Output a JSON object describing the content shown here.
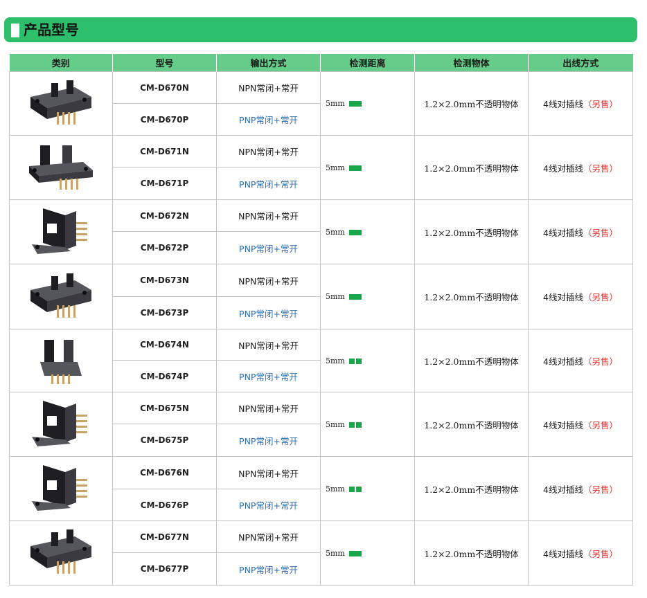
{
  "page": {
    "title": "产品型号"
  },
  "table": {
    "headers": [
      "类别",
      "型号",
      "输出方式",
      "检测距离",
      "检测物体",
      "出线方式"
    ],
    "rows": [
      {
        "model_n": "CM-D670N",
        "model_p": "CM-D670P",
        "output_npn": "NPN常闭+常开",
        "output_pnp": "PNP常闭+常开",
        "distance": "5mm",
        "object": "1.2×2.0mm不透明物体",
        "wiring": "4线对插线",
        "wiring_note": "（另售）",
        "marker": "solid",
        "product_icon": "slot-optical-sensor-icon"
      },
      {
        "model_n": "CM-D671N",
        "model_p": "CM-D671P",
        "output_npn": "NPN常闭+常开",
        "output_pnp": "PNP常闭+常开",
        "distance": "5mm",
        "object": "1.2×2.0mm不透明物体",
        "wiring": "4线对插线",
        "wiring_note": "（另售）",
        "marker": "solid",
        "product_icon": "slot-optical-sensor-icon"
      },
      {
        "model_n": "CM-D672N",
        "model_p": "CM-D672P",
        "output_npn": "NPN常闭+常开",
        "output_pnp": "PNP常闭+常开",
        "distance": "5mm",
        "object": "1.2×2.0mm不透明物体",
        "wiring": "4线对插线",
        "wiring_note": "（另售）",
        "marker": "solid",
        "product_icon": "slot-optical-sensor-icon"
      },
      {
        "model_n": "CM-D673N",
        "model_p": "CM-D673P",
        "output_npn": "NPN常闭+常开",
        "output_pnp": "PNP常闭+常开",
        "distance": "5mm",
        "object": "1.2×2.0mm不透明物体",
        "wiring": "4线对插线",
        "wiring_note": "（另售）",
        "marker": "solid",
        "product_icon": "slot-optical-sensor-icon"
      },
      {
        "model_n": "CM-D674N",
        "model_p": "CM-D674P",
        "output_npn": "NPN常闭+常开",
        "output_pnp": "PNP常闭+常开",
        "distance": "5mm",
        "object": "1.2×2.0mm不透明物体",
        "wiring": "4线对插线",
        "wiring_note": "（另售）",
        "marker": "split",
        "product_icon": "slot-optical-sensor-icon"
      },
      {
        "model_n": "CM-D675N",
        "model_p": "CM-D675P",
        "output_npn": "NPN常闭+常开",
        "output_pnp": "PNP常闭+常开",
        "distance": "5mm",
        "object": "1.2×2.0mm不透明物体",
        "wiring": "4线对插线",
        "wiring_note": "（另售）",
        "marker": "split",
        "product_icon": "slot-optical-sensor-icon"
      },
      {
        "model_n": "CM-D676N",
        "model_p": "CM-D676P",
        "output_npn": "NPN常闭+常开",
        "output_pnp": "PNP常闭+常开",
        "distance": "5mm",
        "object": "1.2×2.0mm不透明物体",
        "wiring": "4线对插线",
        "wiring_note": "（另售）",
        "marker": "split",
        "product_icon": "slot-optical-sensor-icon"
      },
      {
        "model_n": "CM-D677N",
        "model_p": "CM-D677P",
        "output_npn": "NPN常闭+常开",
        "output_pnp": "PNP常闭+常开",
        "distance": "5mm",
        "object": "1.2×2.0mm不透明物体",
        "wiring": "4线对插线",
        "wiring_note": "（另售）",
        "marker": "solid",
        "product_icon": "slot-optical-sensor-icon"
      }
    ]
  },
  "colors": {
    "title_bar": "#2dbf6c",
    "header_bg": "#66cc8a",
    "pnp_text": "#2a6fb6",
    "sold_separately": "#e0312b",
    "distance_marker": "#18a84a"
  }
}
